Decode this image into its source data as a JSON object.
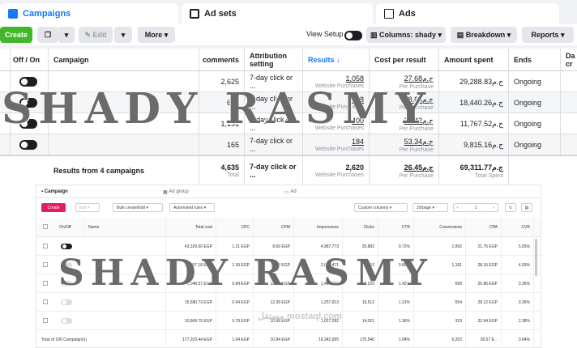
{
  "top": {
    "tabs": [
      {
        "label": "Campaigns"
      },
      {
        "label": "Ad sets"
      },
      {
        "label": "Ads"
      }
    ],
    "toolbar": {
      "create": "Create",
      "edit": "Edit",
      "more": "More",
      "view_setup": "View Setup",
      "columns": "Columns: shady",
      "breakdown": "Breakdown",
      "reports": "Reports"
    },
    "headers": {
      "off_on": "Off / On",
      "campaign": "Campaign",
      "comments": "comments",
      "attribution": "Attribution setting",
      "results": "Results",
      "cost_per_result": "Cost per result",
      "amount_spent": "Amount spent",
      "ends": "Ends",
      "date_created": "Da cr"
    },
    "rows": [
      {
        "comments": "2,625",
        "attribution": "7-day click or ...",
        "results": "1,058",
        "results_sub": "Website Purchases",
        "cpr": "27.68ج.م",
        "cpr_sub": "Per Purchase",
        "spent": "29,288.83ج.م",
        "ends": "Ongoing",
        "on": true
      },
      {
        "comments": "694",
        "attribution": "7-day click or ...",
        "results": "978",
        "results_sub": "Website Purchases",
        "cpr": "18.86ج.م",
        "cpr_sub": "Per Purchase",
        "spent": "18,440.26ج.م",
        "ends": "Ongoing",
        "on": true
      },
      {
        "comments": "1,151",
        "attribution": "7-day click or ...",
        "results": "400",
        "results_sub": "Website Purchases",
        "cpr": "29.42ج.م",
        "cpr_sub": "Per Purchase",
        "spent": "11,767.52ج.م",
        "ends": "Ongoing",
        "on": true
      },
      {
        "comments": "165",
        "attribution": "7-day click or ...",
        "results": "184",
        "results_sub": "Website Purchases",
        "cpr": "53.34ج.م",
        "cpr_sub": "Per Purchase",
        "spent": "9,815.16ج.م",
        "ends": "Ongoing",
        "on": true
      }
    ],
    "total": {
      "label": "Results from 4 campaigns",
      "comments": "4,635",
      "comments_sub": "Total",
      "attribution": "7-day click or ...",
      "results": "2,620",
      "results_sub": "Website Purchases",
      "cpr": "26.45ج.م",
      "cpr_sub": "Per Purchase",
      "spent": "69,311.77ج.م",
      "spent_sub": "Total Spent"
    }
  },
  "watermark": "SHADY RASMY",
  "bottom": {
    "tabs": {
      "campaign": "Campaign",
      "ad_group": "Ad group",
      "ad": "Ad"
    },
    "toolbar": {
      "create": "Create",
      "edit": "Edit",
      "bulk": "Bulk create/Edit",
      "automated": "Automated rules",
      "custom_columns": "Custom columns",
      "per_page": "20/page",
      "page": "1"
    },
    "headers": [
      "On/Off",
      "Name",
      "Total cost",
      "CPC",
      "CPM",
      "Impressions",
      "Clicks",
      "CTR",
      "Conversions",
      "CPA",
      "CVR"
    ],
    "rows": [
      {
        "on": true,
        "cost": "43,329.50 EGP",
        "cpc": "1.21 EGP",
        "cpm": "8.69 EGP",
        "impr": "4,987,773",
        "clicks": "35,882",
        "ctr": "0.72%",
        "conv": "1,992",
        "cpa": "21.75 EGP",
        "cvr": "5.55%"
      },
      {
        "on": false,
        "cost": "33,257.18 EGP",
        "cpc": "1.39 EGP",
        "cpm": "12.34 EGP",
        "impr": "2,694,471",
        "clicks": "23,952",
        "ctr": "0.89%",
        "conv": "1,181",
        "cpa": "28.16 EGP",
        "cvr": "4.93%"
      },
      {
        "on": false,
        "cost": "18,048.57 EGP",
        "cpc": "0.84 EGP",
        "cpm": "18.99 EGP",
        "impr": "1,425,237",
        "clicks": "20,229",
        "ctr": "1.42%",
        "conv": "699",
        "cpa": "25.86 EGP",
        "cvr": "3.36%"
      },
      {
        "on": false,
        "cost": "15,580.73 EGP",
        "cpc": "0.94 EGP",
        "cpm": "12.39 EGP",
        "impr": "1,257,913",
        "clicks": "16,512",
        "ctr": "1.31%",
        "conv": "554",
        "cpa": "28.12 EGP",
        "cvr": "3.36%"
      },
      {
        "on": false,
        "cost": "10,969.75 EGP",
        "cpc": "0.78 EGP",
        "cpm": "10.68 EGP",
        "impr": "1,027,282",
        "clicks": "14,021",
        "ctr": "1.36%",
        "conv": "333",
        "cpa": "32.94 EGP",
        "cvr": "2.38%"
      }
    ],
    "total": {
      "label": "Total of 106 Campaign(s)",
      "cost": "177,203.44 EGP",
      "cpc": "1.04 EGP",
      "cpm": "10.84 EGP",
      "impr": "16,342,995",
      "clicks": "170,540",
      "ctr": "1.04%",
      "conv": "6,202",
      "cpa": "28.57 E...",
      "cvr": "3.64%"
    }
  },
  "logo": "مستقل mostaql.com"
}
